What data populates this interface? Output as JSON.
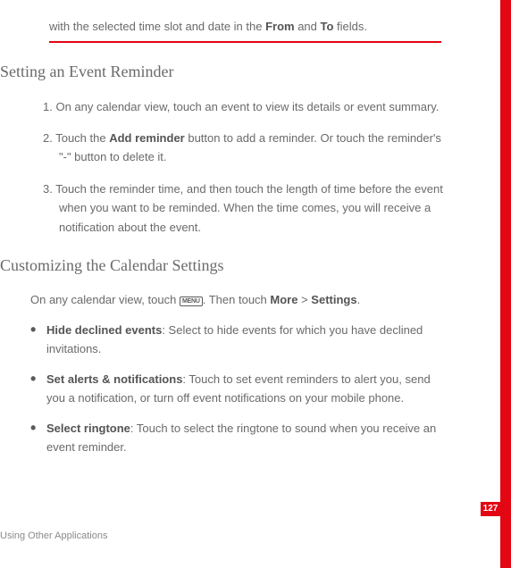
{
  "intro": {
    "pre": "with the selected time slot and date in the ",
    "b1": "From",
    "mid": " and ",
    "b2": "To",
    "post": " fields."
  },
  "section1": {
    "title": "Setting an Event Reminder"
  },
  "s1_item1": "1. On any calendar view, touch an event to view its details or event summary.",
  "s1_item2": {
    "pre": "2. Touch the ",
    "b": "Add reminder",
    "post": " button to add a reminder. Or touch the reminder's \"-\" button to delete it."
  },
  "s1_item3": "3. Touch the reminder time, and then touch the length of time before the event when you want to be reminded. When the time comes, you will receive a notification about the event.",
  "section2": {
    "title": "Customizing the Calendar Settings"
  },
  "s2_body": {
    "pre": "On any calendar view, touch ",
    "menu": "MENU",
    "mid": ". Then touch ",
    "b1": "More",
    "gt": " > ",
    "b2": "Settings",
    "post": "."
  },
  "s2_b1": {
    "b": "Hide declined events",
    "post": ": Select to hide events for which you have declined invitations."
  },
  "s2_b2": {
    "b": "Set alerts & notifications",
    "post": ": Touch to set event reminders to alert you, send you a notification, or turn off event notifications on your mobile phone."
  },
  "s2_b3": {
    "b": "Select ringtone",
    "post": ": Touch to select the ringtone to sound when you receive an event reminder."
  },
  "footer": "Using Other Applications",
  "page_number": "127"
}
